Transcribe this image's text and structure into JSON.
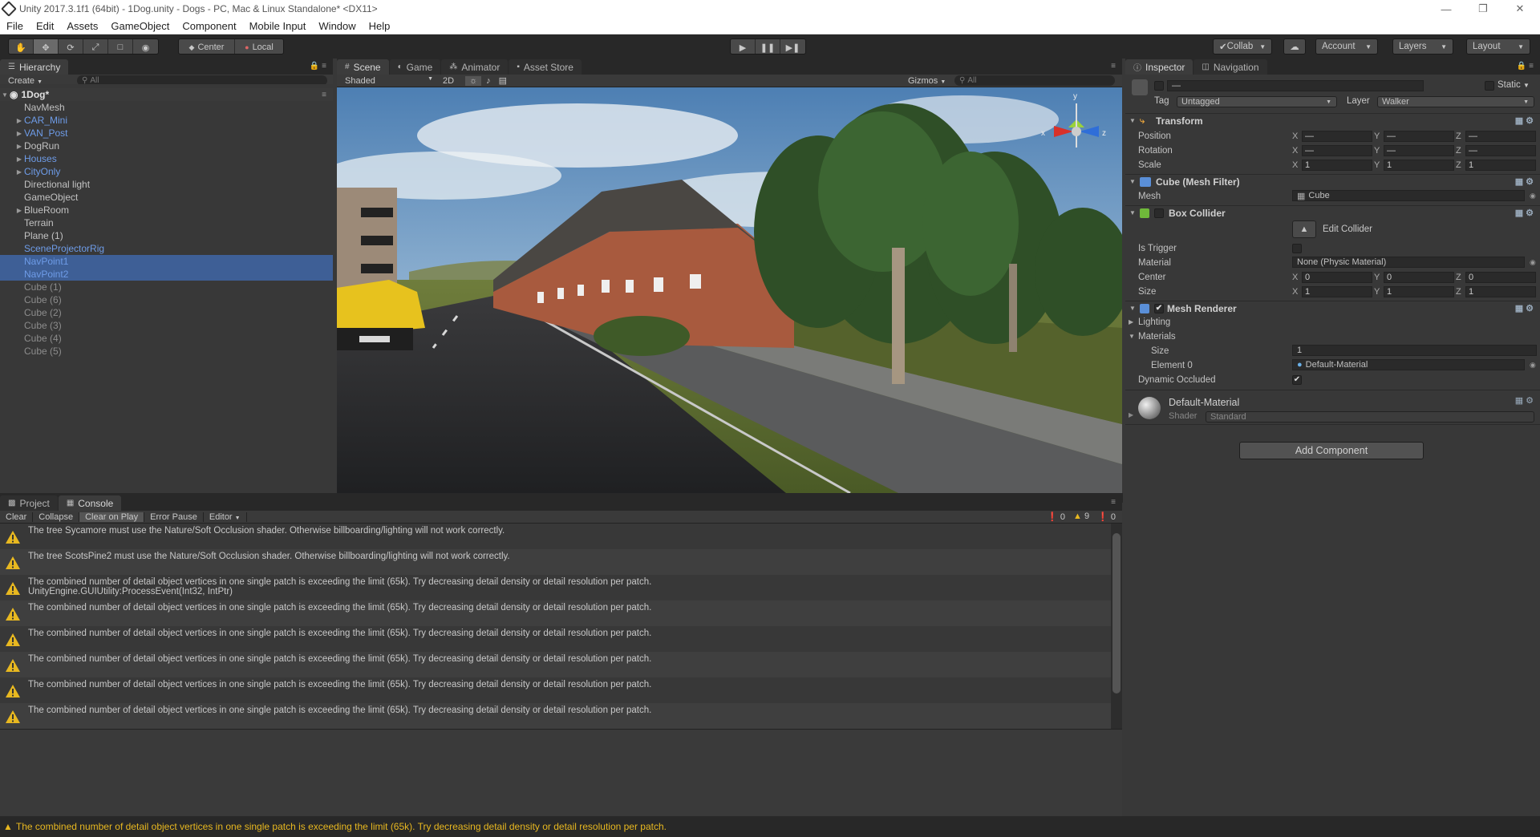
{
  "window": {
    "title": "Unity 2017.3.1f1 (64bit) - 1Dog.unity - Dogs - PC, Mac & Linux Standalone* <DX11>"
  },
  "menu": [
    "File",
    "Edit",
    "Assets",
    "GameObject",
    "Component",
    "Mobile Input",
    "Window",
    "Help"
  ],
  "toolbar": {
    "center_label": "Center",
    "local_label": "Local",
    "collab_label": "Collab",
    "account_label": "Account",
    "layers_label": "Layers",
    "layout_label": "Layout"
  },
  "hierarchy": {
    "tab_label": "Hierarchy",
    "create_label": "Create",
    "search_placeholder": "All",
    "scene_name": "1Dog*",
    "items": [
      {
        "label": "NavMesh",
        "style": "normal",
        "arrow": ""
      },
      {
        "label": "CAR_Mini",
        "style": "prefab",
        "arrow": "▶"
      },
      {
        "label": "VAN_Post",
        "style": "prefab",
        "arrow": "▶"
      },
      {
        "label": "DogRun",
        "style": "normal",
        "arrow": "▶"
      },
      {
        "label": "Houses",
        "style": "prefab",
        "arrow": "▶"
      },
      {
        "label": "CityOnly",
        "style": "prefab",
        "arrow": "▶"
      },
      {
        "label": "Directional light",
        "style": "normal",
        "arrow": ""
      },
      {
        "label": "GameObject",
        "style": "normal",
        "arrow": ""
      },
      {
        "label": "BlueRoom",
        "style": "normal",
        "arrow": "▶"
      },
      {
        "label": "Terrain",
        "style": "normal",
        "arrow": ""
      },
      {
        "label": "Plane (1)",
        "style": "normal",
        "arrow": ""
      },
      {
        "label": "SceneProjectorRig",
        "style": "prefab",
        "arrow": ""
      },
      {
        "label": "NavPoint1",
        "style": "sel",
        "arrow": ""
      },
      {
        "label": "NavPoint2",
        "style": "sel",
        "arrow": ""
      },
      {
        "label": "Cube (1)",
        "style": "disabled",
        "arrow": ""
      },
      {
        "label": "Cube (6)",
        "style": "disabled",
        "arrow": ""
      },
      {
        "label": "Cube (2)",
        "style": "disabled",
        "arrow": ""
      },
      {
        "label": "Cube (3)",
        "style": "disabled",
        "arrow": ""
      },
      {
        "label": "Cube (4)",
        "style": "disabled",
        "arrow": ""
      },
      {
        "label": "Cube (5)",
        "style": "disabled",
        "arrow": ""
      }
    ]
  },
  "scene": {
    "tabs": [
      {
        "label": "Scene",
        "icon": "#"
      },
      {
        "label": "Game",
        "icon": "◐"
      },
      {
        "label": "Animator",
        "icon": "⁂"
      },
      {
        "label": "Asset Store",
        "icon": "▪"
      }
    ],
    "shading": "Shaded",
    "mode_2d": "2D",
    "gizmos": "Gizmos",
    "search_placeholder": "All"
  },
  "inspector": {
    "tabs": [
      "Inspector",
      "Navigation"
    ],
    "static_label": "Static",
    "name_value": "—",
    "tag_label": "Tag",
    "tag_value": "Untagged",
    "layer_label": "Layer",
    "layer_value": "Walker",
    "transform": {
      "title": "Transform",
      "position_label": "Position",
      "rotation_label": "Rotation",
      "scale_label": "Scale",
      "position": [
        "—",
        "—",
        "—"
      ],
      "rotation": [
        "—",
        "—",
        "—"
      ],
      "scale": [
        "1",
        "1",
        "1"
      ]
    },
    "mesh_filter": {
      "title": "Cube (Mesh Filter)",
      "mesh_label": "Mesh",
      "mesh_value": "Cube"
    },
    "box_collider": {
      "title": "Box Collider",
      "edit_label": "Edit Collider",
      "is_trigger_label": "Is Trigger",
      "material_label": "Material",
      "material_value": "None (Physic Material)",
      "center_label": "Center",
      "size_label": "Size",
      "center": [
        "0",
        "0",
        "0"
      ],
      "size": [
        "1",
        "1",
        "1"
      ]
    },
    "mesh_renderer": {
      "title": "Mesh Renderer",
      "lighting_label": "Lighting",
      "materials_label": "Materials",
      "size_label": "Size",
      "size_value": "1",
      "element0_label": "Element 0",
      "element0_value": "Default-Material",
      "dynamic_occluded_label": "Dynamic Occluded"
    },
    "material": {
      "name": "Default-Material",
      "shader_label": "Shader",
      "shader_value": "Standard"
    },
    "add_component_label": "Add Component"
  },
  "bottom": {
    "tabs": [
      "Project",
      "Console"
    ],
    "toolbar": [
      "Clear",
      "Collapse",
      "Clear on Play",
      "Error Pause",
      "Editor"
    ],
    "counts": {
      "errors": "0",
      "warnings": "9",
      "messages": "0"
    },
    "messages": [
      {
        "line1": "The tree Sycamore must use the Nature/Soft Occlusion shader. Otherwise billboarding/lighting will not work correctly.",
        "line2": ""
      },
      {
        "line1": "The tree ScotsPine2 must use the Nature/Soft Occlusion shader. Otherwise billboarding/lighting will not work correctly.",
        "line2": ""
      },
      {
        "line1": "The combined number of detail object vertices in one single patch is exceeding the limit (65k). Try decreasing detail density or detail resolution per patch.",
        "line2": "UnityEngine.GUIUtility:ProcessEvent(Int32, IntPtr)"
      },
      {
        "line1": "The combined number of detail object vertices in one single patch is exceeding the limit (65k). Try decreasing detail density or detail resolution per patch.",
        "line2": ""
      },
      {
        "line1": "The combined number of detail object vertices in one single patch is exceeding the limit (65k). Try decreasing detail density or detail resolution per patch.",
        "line2": ""
      },
      {
        "line1": "The combined number of detail object vertices in one single patch is exceeding the limit (65k). Try decreasing detail density or detail resolution per patch.",
        "line2": ""
      },
      {
        "line1": "The combined number of detail object vertices in one single patch is exceeding the limit (65k). Try decreasing detail density or detail resolution per patch.",
        "line2": ""
      },
      {
        "line1": "The combined number of detail object vertices in one single patch is exceeding the limit (65k). Try decreasing detail density or detail resolution per patch.",
        "line2": ""
      }
    ]
  },
  "status": {
    "message": "The combined number of detail object vertices in one single patch is exceeding the limit (65k). Try decreasing detail density or detail resolution per patch."
  },
  "colors": {
    "selection": "#3e5f96",
    "prefab_text": "#6e9ce8",
    "warning": "#e8b820"
  }
}
